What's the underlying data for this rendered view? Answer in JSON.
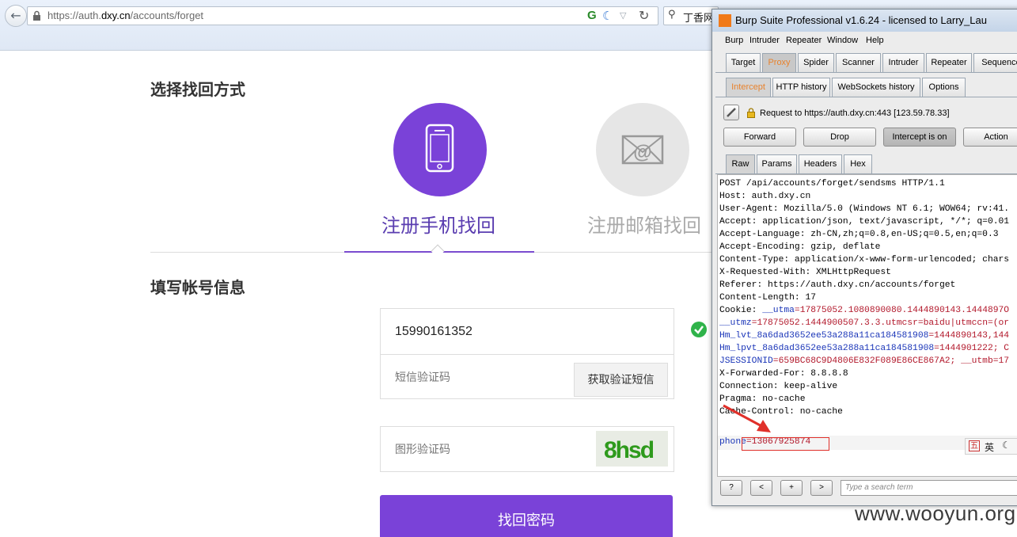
{
  "browser": {
    "url_prefix": "https://auth.",
    "url_domain": "dxy.cn",
    "url_path": "/accounts/forget",
    "search_text": "丁香网"
  },
  "page": {
    "section1_title": "选择找回方式",
    "method_phone_label": "注册手机找回",
    "method_email_label": "注册邮箱找回",
    "section2_title": "填写帐号信息",
    "phone_value": "15990161352",
    "sms_code_placeholder": "短信验证码",
    "sms_button_label": "获取验证短信",
    "captcha_placeholder": "图形验证码",
    "captcha_text": "8hsd",
    "submit_label": "找回密码",
    "colors": {
      "accent": "#7a42d8",
      "inactive_circle": "#e6e6e6",
      "check": "#2fb34a"
    }
  },
  "burp": {
    "title": "Burp Suite Professional v1.6.24 - licensed to Larry_Lau",
    "menu": [
      "Burp",
      "Intruder",
      "Repeater",
      "Window",
      "Help"
    ],
    "main_tabs": [
      "Target",
      "Proxy",
      "Spider",
      "Scanner",
      "Intruder",
      "Repeater",
      "Sequence"
    ],
    "proxy_tabs": [
      "Intercept",
      "HTTP history",
      "WebSockets history",
      "Options"
    ],
    "request_info": "Request to https://auth.dxy.cn:443  [123.59.78.33]",
    "buttons": {
      "forward": "Forward",
      "drop": "Drop",
      "intercept": "Intercept is on",
      "action": "Action"
    },
    "view_tabs": [
      "Raw",
      "Params",
      "Headers",
      "Hex"
    ],
    "request_lines": [
      "POST /api/accounts/forget/sendsms HTTP/1.1",
      "Host: auth.dxy.cn",
      "User-Agent: Mozilla/5.0 (Windows NT 6.1; WOW64; rv:41.",
      "Accept: application/json, text/javascript, */*; q=0.01",
      "Accept-Language: zh-CN,zh;q=0.8,en-US;q=0.5,en;q=0.3",
      "Accept-Encoding: gzip, deflate",
      "Content-Type: application/x-www-form-urlencoded; chars",
      "X-Requested-With: XMLHttpRequest",
      "Referer: https://auth.dxy.cn/accounts/forget",
      "Content-Length: 17"
    ],
    "cookie_lines": [
      {
        "prefix": "Cookie: ",
        "name": "__utma",
        "value": "=17875052.1080890080.1444890143.1444897O"
      },
      {
        "prefix": "",
        "name": "__utmz",
        "value": "=17875052.1444900507.3.3.utmcsr=baidu|utmccn=(or"
      },
      {
        "prefix": "",
        "name": "Hm_lvt_8a6dad3652ee53a288a11ca184581908",
        "value": "=1444890143,144"
      },
      {
        "prefix": "",
        "name": "Hm_lpvt_8a6dad3652ee53a288a11ca184581908",
        "value": "=1444901222; C"
      },
      {
        "prefix": "",
        "name": "JSESSIONID",
        "value": "=659BC68C9D4806E832F089E86CE867A2; __utmb=17"
      }
    ],
    "trailing_lines": [
      "X-Forwarded-For: 8.8.8.8",
      "Connection: keep-alive",
      "Pragma: no-cache",
      "Cache-Control: no-cache"
    ],
    "body_param_name": "phone",
    "body_param_value": "=13067925874",
    "ime_label": "英",
    "bottom_buttons": [
      "?",
      "<",
      "+",
      ">"
    ],
    "search_placeholder": "Type a search term"
  },
  "watermark": "www.wooyun.org"
}
